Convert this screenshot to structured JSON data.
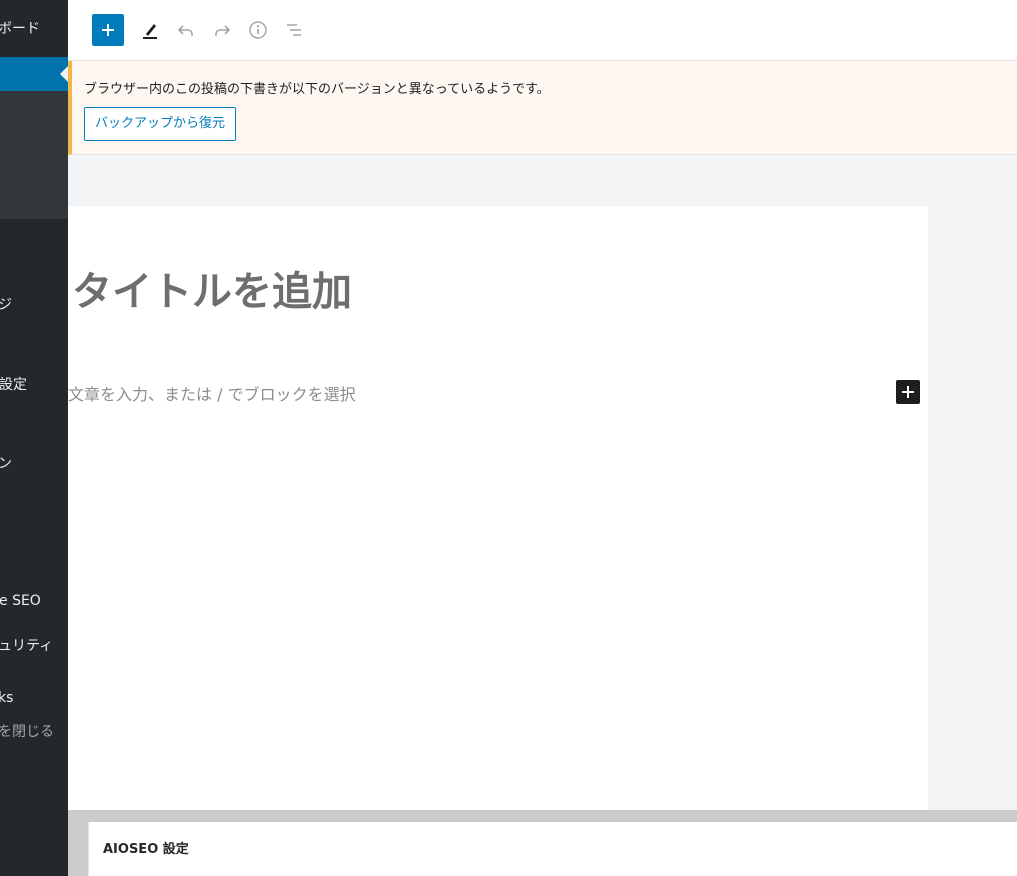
{
  "sidebar": {
    "items": [
      {
        "label": "ボード",
        "dim": false
      },
      {
        "label": "ジ",
        "dim": false
      },
      {
        "label": "設定",
        "dim": false
      },
      {
        "label": "ン",
        "dim": false
      },
      {
        "label": "e SEO",
        "dim": false
      },
      {
        "label": "ュリティ",
        "dim": false
      },
      {
        "label": "ks",
        "dim": false
      },
      {
        "label": "を閉じる",
        "dim": true
      }
    ]
  },
  "toolbar": {
    "icons": [
      "plus-icon",
      "pencil-icon",
      "undo-icon",
      "redo-icon",
      "info-icon",
      "list-view-icon"
    ]
  },
  "notice": {
    "message": "ブラウザー内のこの投稿の下書きが以下のバージョンと異なっているようです。",
    "button_label": "バックアップから復元"
  },
  "editor": {
    "title_placeholder": "タイトルを追加",
    "block_placeholder": "文章を入力、または / でブロックを選択"
  },
  "metabox": {
    "title": "AIOSEO 設定"
  },
  "colors": {
    "accent": "#007cba",
    "sidebar_bg": "#23282d",
    "notice_border": "#f0b849"
  }
}
